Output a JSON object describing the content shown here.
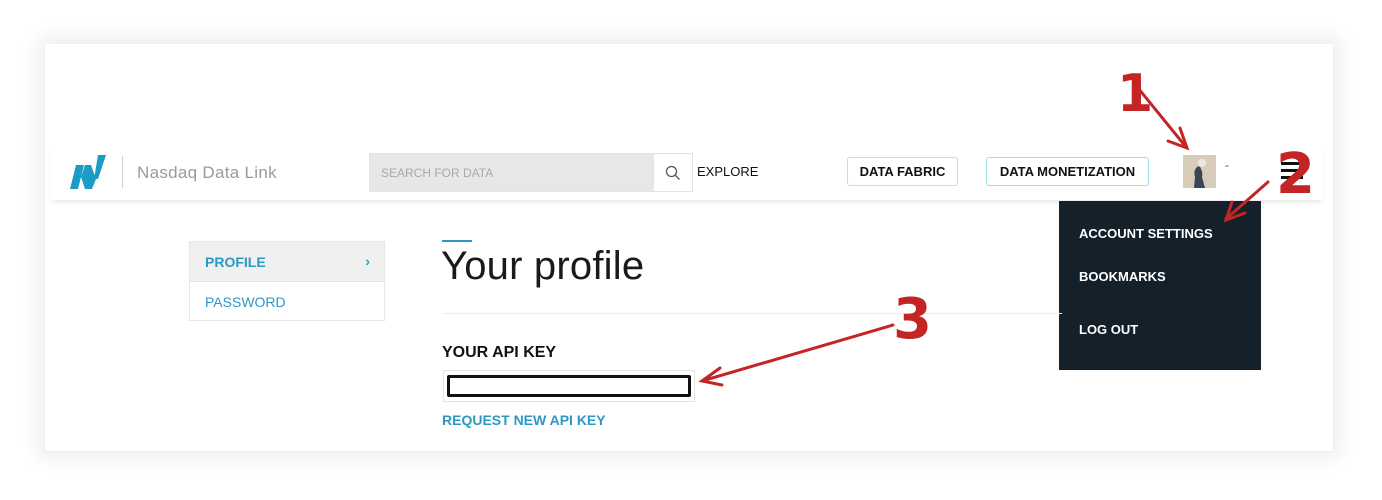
{
  "header": {
    "brand": "Nasdaq Data Link",
    "logo_icon": "nasdaq-logo-icon",
    "search": {
      "placeholder": "SEARCH FOR DATA",
      "value": "",
      "icon": "search-icon"
    },
    "explore_label": "EXPLORE",
    "data_fabric_label": "DATA FABRIC",
    "data_monetization_label": "DATA MONETIZATION",
    "avatar_icon": "user-avatar",
    "caret_icon": "chevron-up-icon",
    "menu_icon": "hamburger-menu-icon",
    "colors": {
      "fabric_border": "#f3d98a",
      "monetization_border": "#9fdfe5"
    }
  },
  "account_menu": {
    "items": [
      {
        "label": "ACCOUNT SETTINGS"
      },
      {
        "label": "BOOKMARKS"
      },
      {
        "label": "LOG OUT"
      }
    ],
    "background": "#14212a"
  },
  "sidebar": {
    "items": [
      {
        "label": "PROFILE",
        "active": true,
        "icon": "chevron-right-icon"
      },
      {
        "label": "PASSWORD",
        "active": false
      }
    ]
  },
  "main": {
    "title": "Your profile",
    "api_key_label": "YOUR API KEY",
    "api_key_value": "",
    "request_link": "REQUEST NEW API KEY",
    "accent_color": "#2e98c5"
  },
  "annotations": [
    {
      "number": "1",
      "color": "#c42424"
    },
    {
      "number": "2",
      "color": "#c42424"
    },
    {
      "number": "3",
      "color": "#c42424"
    }
  ]
}
